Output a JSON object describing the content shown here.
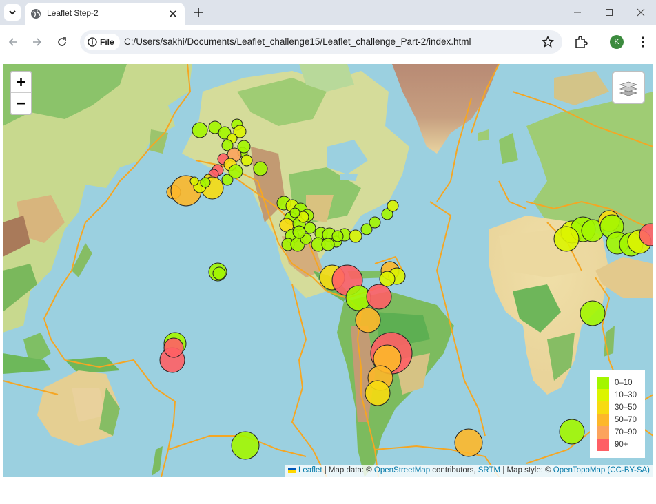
{
  "browser": {
    "tab_title": "Leaflet Step-2",
    "url": "C:/Users/sakhi/Documents/Leaflet_challenge15/Leaflet_challenge_Part-2/index.html",
    "security_chip_label": "File",
    "profile_initial": "K"
  },
  "map": {
    "zoom_in_label": "+",
    "zoom_out_label": "−",
    "legend": [
      {
        "label": "0–10",
        "color": "#a3f600"
      },
      {
        "label": "10–30",
        "color": "#dcf400"
      },
      {
        "label": "30–50",
        "color": "#f7db11"
      },
      {
        "label": "50–70",
        "color": "#fdb72a"
      },
      {
        "label": "70–90",
        "color": "#fca35d"
      },
      {
        "label": "90+",
        "color": "#ff5f65"
      }
    ],
    "attribution": {
      "leaflet": "Leaflet",
      "sep1": " | Map data: © ",
      "osm": "OpenStreetMap",
      "contributors": " contributors, ",
      "srtm": "SRTM",
      "style": " | Map style: © ",
      "otm": "OpenTopoMap (CC-BY-SA)"
    },
    "colors": {
      "ocean": "#9bd0e0",
      "plate_boundary": "#f5a623",
      "quake_0_10": "#a3f600",
      "quake_10_30": "#dcf400",
      "quake_30_50": "#f7db11",
      "quake_50_70": "#fdb72a",
      "quake_70_90": "#fca35d",
      "quake_90_plus": "#ff5f65"
    }
  }
}
